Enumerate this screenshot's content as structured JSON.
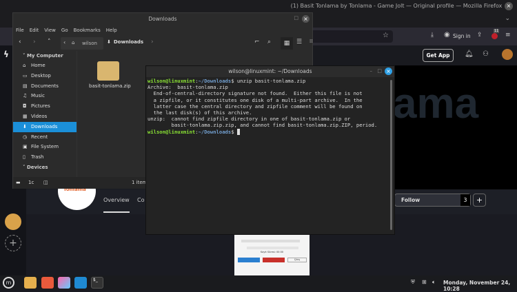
{
  "firefox": {
    "title": "(1) Basit Tonlama by Tonlama - Game Jolt — Original profile — Mozilla Firefox",
    "sign_in": "Sign in",
    "badge_count": "11"
  },
  "gamejolt": {
    "get_app": "Get App",
    "banner_text": "ama",
    "logo_text": "Tonlama",
    "tabs": [
      "Overview",
      "Co"
    ],
    "follow_label": "Follow",
    "follow_count": "3",
    "add_label": "+"
  },
  "file_manager": {
    "title": "Downloads",
    "menu": [
      "File",
      "Edit",
      "View",
      "Go",
      "Bookmarks",
      "Help"
    ],
    "breadcrumb": [
      "wilson",
      "Downloads"
    ],
    "sidebar_sections": {
      "my_computer": "My Computer",
      "devices": "Devices"
    },
    "sidebar_items": [
      {
        "label": "Home",
        "icon": "⌂"
      },
      {
        "label": "Desktop",
        "icon": "▭"
      },
      {
        "label": "Documents",
        "icon": "▤"
      },
      {
        "label": "Music",
        "icon": "♫"
      },
      {
        "label": "Pictures",
        "icon": "◘"
      },
      {
        "label": "Videos",
        "icon": "▦"
      },
      {
        "label": "Downloads",
        "icon": "⬇"
      },
      {
        "label": "Recent",
        "icon": "◷"
      },
      {
        "label": "File System",
        "icon": "▣"
      },
      {
        "label": "Trash",
        "icon": "▯"
      }
    ],
    "active_item": "Downloads",
    "file_name": "basit-tonlama.zip",
    "status": "1 item,"
  },
  "terminal": {
    "title": "wilson@linuxmint: ~/Downloads",
    "prompt_user": "wilson@linuxmint",
    "prompt_path": "~/Downloads",
    "command": "unzip basit-tonlama.zip",
    "output": [
      "Archive:  basit-tonlama.zip",
      "  End-of-central-directory signature not found.  Either this file is not",
      "  a zipfile, or it constitutes one disk of a multi-part archive.  In the",
      "  latter case the central directory and zipfile comment will be found on",
      "  the last disk(s) of this archive.",
      "unzip:  cannot find zipfile directory in one of basit-tonlama.zip or",
      "        basit-tonlama.zip.zip, and cannot find basit-tonlama.zip.ZIP, period."
    ]
  },
  "thumbnail": {
    "time_label": "Kayıt Süresi: 00:00",
    "cancel": "Çıkış"
  },
  "taskbar": {
    "clock": "Monday, November 24, 10:28"
  }
}
